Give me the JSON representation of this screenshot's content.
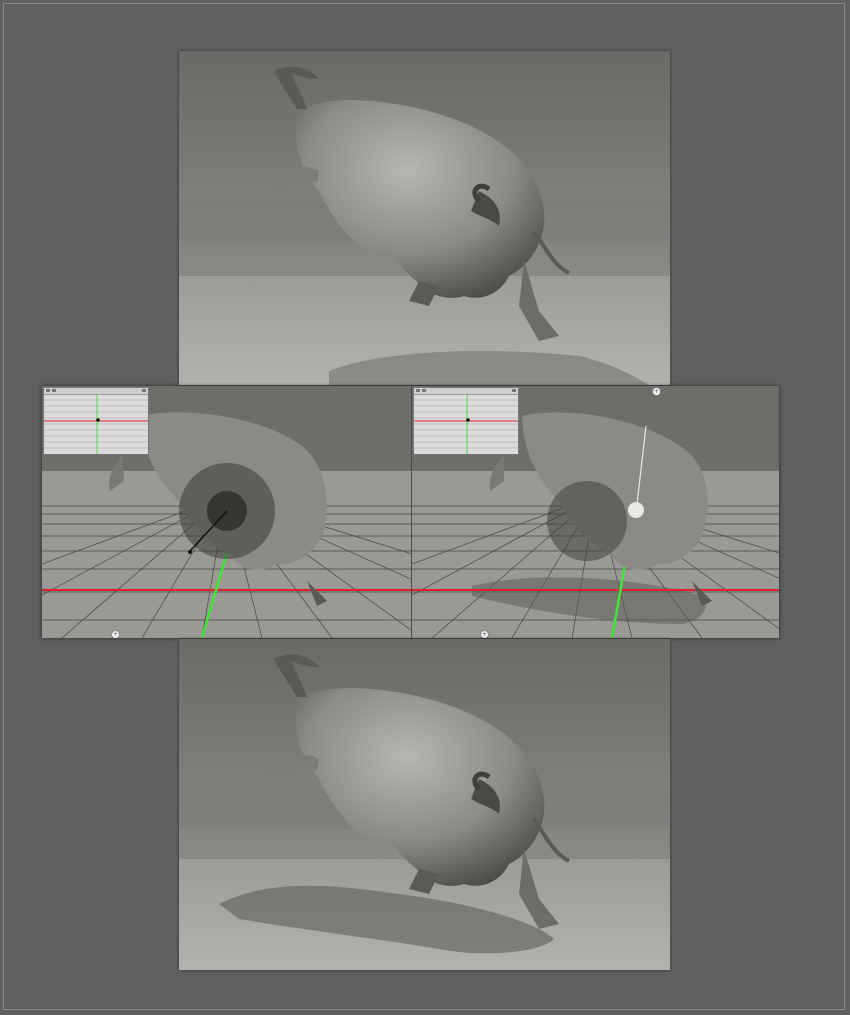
{
  "app": {
    "description_free": true
  },
  "renders": {
    "top": {
      "icon": "bull-render-before"
    },
    "bottom": {
      "icon": "bull-render-after"
    }
  },
  "viewports": {
    "left": {
      "icon": "viewport-light-sphere",
      "minimap": "top-view-grid"
    },
    "right": {
      "icon": "viewport-light-sphere",
      "minimap": "top-view-grid"
    }
  },
  "colors": {
    "background": "#5f5f5f",
    "grid_red_axis": "#e0202a",
    "grid_green_axis": "#3ee63a",
    "viewport_grid": "#222222"
  }
}
